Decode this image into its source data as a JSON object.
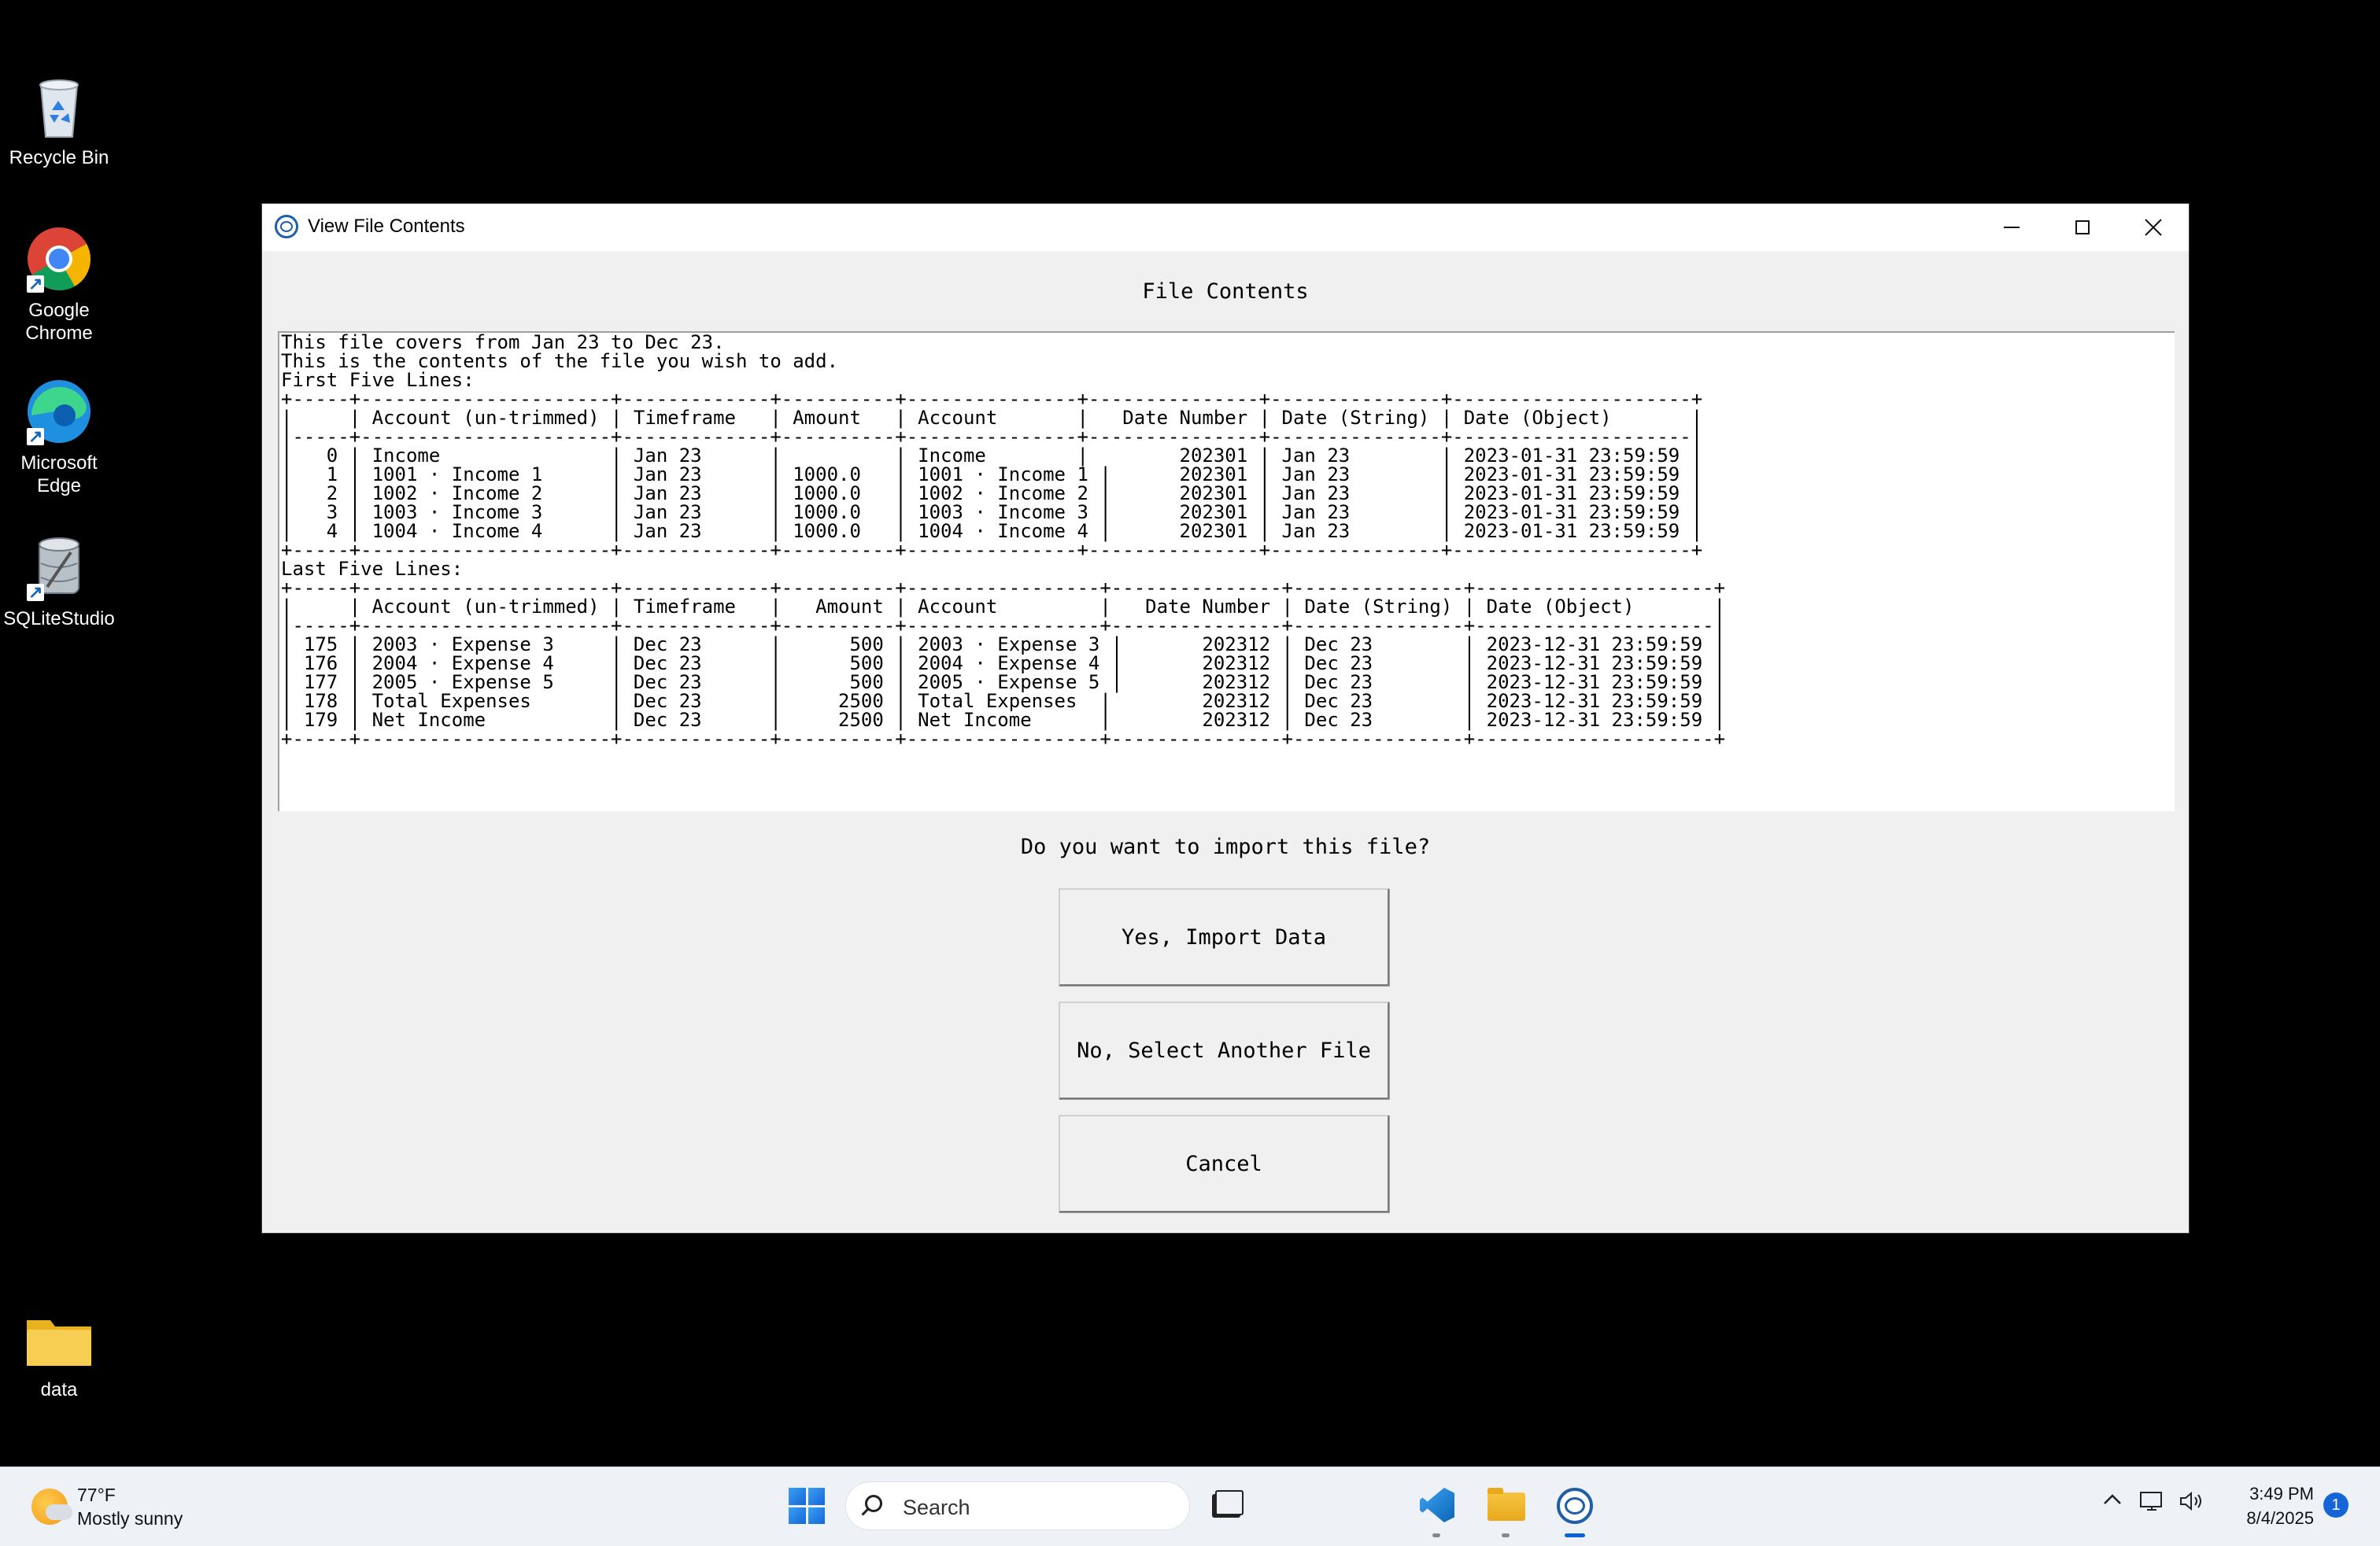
{
  "desktop": {
    "icons": [
      {
        "label": "Recycle Bin"
      },
      {
        "label": "Google Chrome"
      },
      {
        "label": "Microsoft Edge"
      },
      {
        "label": "SQLiteStudio"
      },
      {
        "label": "data"
      }
    ]
  },
  "window": {
    "title": "View File Contents",
    "heading": "File Contents",
    "content_lines": [
      "This file covers from Jan 23 to Dec 23.",
      "This is the contents of the file you wish to add.",
      "First Five Lines:",
      "+-----+----------------------+-------------+----------+---------------+---------------+---------------+---------------------+",
      "|     | Account (un-trimmed) | Timeframe   | Amount   | Account       |   Date Number | Date (String) | Date (Object)       |",
      "|-----+----------------------+-------------+----------+---------------+---------------+---------------+---------------------|",
      "|   0 | Income               | Jan 23      |          | Income        |        202301 | Jan 23        | 2023-01-31 23:59:59 |",
      "|   1 | 1001 · Income 1      | Jan 23      | 1000.0   | 1001 · Income 1 |      202301 | Jan 23        | 2023-01-31 23:59:59 |",
      "|   2 | 1002 · Income 2      | Jan 23      | 1000.0   | 1002 · Income 2 |      202301 | Jan 23        | 2023-01-31 23:59:59 |",
      "|   3 | 1003 · Income 3      | Jan 23      | 1000.0   | 1003 · Income 3 |      202301 | Jan 23        | 2023-01-31 23:59:59 |",
      "|   4 | 1004 · Income 4      | Jan 23      | 1000.0   | 1004 · Income 4 |      202301 | Jan 23        | 2023-01-31 23:59:59 |",
      "+-----+----------------------+-------------+----------+---------------+---------------+---------------+---------------------+",
      "Last Five Lines:",
      "+-----+----------------------+-------------+----------+-----------------+---------------+---------------+---------------------+",
      "|     | Account (un-trimmed) | Timeframe   |   Amount | Account         |   Date Number | Date (String) | Date (Object)       |",
      "|-----+----------------------+-------------+----------+-----------------+---------------+---------------+---------------------|",
      "| 175 | 2003 · Expense 3     | Dec 23      |      500 | 2003 · Expense 3 |       202312 | Dec 23        | 2023-12-31 23:59:59 |",
      "| 176 | 2004 · Expense 4     | Dec 23      |      500 | 2004 · Expense 4 |       202312 | Dec 23        | 2023-12-31 23:59:59 |",
      "| 177 | 2005 · Expense 5     | Dec 23      |      500 | 2005 · Expense 5 |       202312 | Dec 23        | 2023-12-31 23:59:59 |",
      "| 178 | Total Expenses       | Dec 23      |     2500 | Total Expenses  |        202312 | Dec 23        | 2023-12-31 23:59:59 |",
      "| 179 | Net Income           | Dec 23      |     2500 | Net Income      |        202312 | Dec 23        | 2023-12-31 23:59:59 |",
      "+-----+----------------------+-------------+----------+-----------------+---------------+---------------+---------------------+"
    ],
    "question": "Do you want to import this file?",
    "buttons": {
      "yes": "Yes, Import Data",
      "no": "No, Select Another File",
      "cancel": "Cancel"
    }
  },
  "taskbar": {
    "weather_temp": "77°F",
    "weather_desc": "Mostly sunny",
    "search_placeholder": "Search",
    "time": "3:49 PM",
    "date": "8/4/2025",
    "notification_count": "1"
  }
}
